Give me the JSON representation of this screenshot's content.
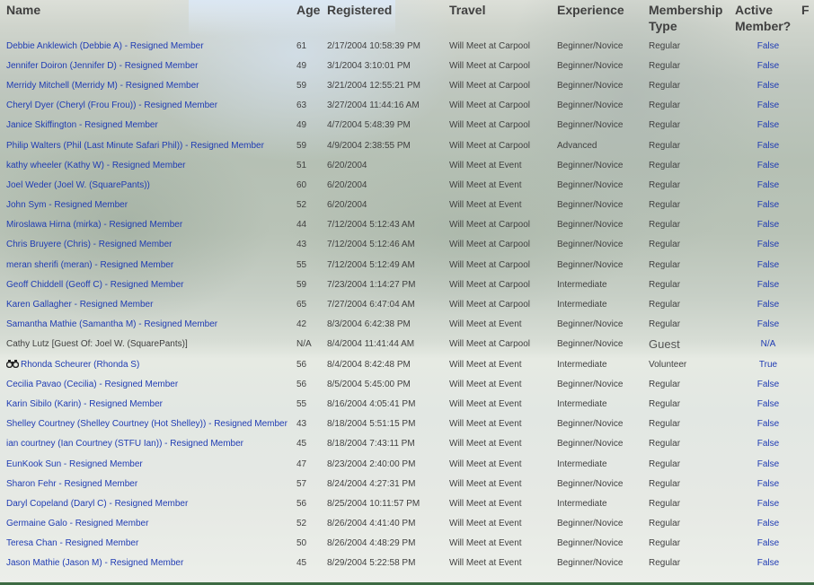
{
  "headers": {
    "name": "Name",
    "age": "Age",
    "registered": "Registered",
    "travel": "Travel",
    "experience": "Experience",
    "membership_type": "Membership Type",
    "active_member": "Active Member?",
    "extra": "F"
  },
  "rows": [
    {
      "name": "Debbie Anklewich (Debbie A) - Resigned Member",
      "age": "61",
      "registered": "2/17/2004 10:58:39 PM",
      "travel": "Will Meet at Carpool",
      "experience": "Beginner/Novice",
      "membership": "Regular",
      "active": "False"
    },
    {
      "name": "Jennifer Doiron (Jennifer D) - Resigned Member",
      "age": "49",
      "registered": "3/1/2004 3:10:01 PM",
      "travel": "Will Meet at Carpool",
      "experience": "Beginner/Novice",
      "membership": "Regular",
      "active": "False"
    },
    {
      "name": "Merridy Mitchell (Merridy M) - Resigned Member",
      "age": "59",
      "registered": "3/21/2004 12:55:21 PM",
      "travel": "Will Meet at Carpool",
      "experience": "Beginner/Novice",
      "membership": "Regular",
      "active": "False"
    },
    {
      "name": "Cheryl Dyer (Cheryl (Frou Frou)) - Resigned Member",
      "age": "63",
      "registered": "3/27/2004 11:44:16 AM",
      "travel": "Will Meet at Carpool",
      "experience": "Beginner/Novice",
      "membership": "Regular",
      "active": "False"
    },
    {
      "name": "Janice Skiffington - Resigned Member",
      "age": "49",
      "registered": "4/7/2004 5:48:39 PM",
      "travel": "Will Meet at Carpool",
      "experience": "Beginner/Novice",
      "membership": "Regular",
      "active": "False"
    },
    {
      "name": "Philip Walters (Phil (Last Minute Safari Phil)) - Resigned Member",
      "age": "59",
      "registered": "4/9/2004 2:38:55 PM",
      "travel": "Will Meet at Carpool",
      "experience": "Advanced",
      "membership": "Regular",
      "active": "False"
    },
    {
      "name": "kathy wheeler (Kathy W) - Resigned Member",
      "age": "51",
      "registered": "6/20/2004",
      "travel": "Will Meet at Event",
      "experience": "Beginner/Novice",
      "membership": "Regular",
      "active": "False"
    },
    {
      "name": "Joel Weder (Joel W. (SquarePants))",
      "age": "60",
      "registered": "6/20/2004",
      "travel": "Will Meet at Event",
      "experience": "Beginner/Novice",
      "membership": "Regular",
      "active": "False"
    },
    {
      "name": "John Sym - Resigned Member",
      "age": "52",
      "registered": "6/20/2004",
      "travel": "Will Meet at Event",
      "experience": "Beginner/Novice",
      "membership": "Regular",
      "active": "False"
    },
    {
      "name": "Miroslawa Hirna (mirka) - Resigned Member",
      "age": "44",
      "registered": "7/12/2004 5:12:43 AM",
      "travel": "Will Meet at Carpool",
      "experience": "Beginner/Novice",
      "membership": "Regular",
      "active": "False"
    },
    {
      "name": "Chris Bruyere (Chris) - Resigned Member",
      "age": "43",
      "registered": "7/12/2004 5:12:46 AM",
      "travel": "Will Meet at Carpool",
      "experience": "Beginner/Novice",
      "membership": "Regular",
      "active": "False"
    },
    {
      "name": "meran sherifi (meran) - Resigned Member",
      "age": "55",
      "registered": "7/12/2004 5:12:49 AM",
      "travel": "Will Meet at Carpool",
      "experience": "Beginner/Novice",
      "membership": "Regular",
      "active": "False"
    },
    {
      "name": "Geoff Chiddell (Geoff C) - Resigned Member",
      "age": "59",
      "registered": "7/23/2004 1:14:27 PM",
      "travel": "Will Meet at Carpool",
      "experience": "Intermediate",
      "membership": "Regular",
      "active": "False"
    },
    {
      "name": "Karen Gallagher - Resigned Member",
      "age": "65",
      "registered": "7/27/2004 6:47:04 AM",
      "travel": "Will Meet at Carpool",
      "experience": "Intermediate",
      "membership": "Regular",
      "active": "False"
    },
    {
      "name": "Samantha Mathie (Samantha M) - Resigned Member",
      "age": "42",
      "registered": "8/3/2004 6:42:38 PM",
      "travel": "Will Meet at Event",
      "experience": "Beginner/Novice",
      "membership": "Regular",
      "active": "False"
    },
    {
      "name": "Cathy Lutz [Guest Of: Joel W. (SquarePants)]",
      "age": "N/A",
      "registered": "8/4/2004 11:41:44 AM",
      "travel": "Will Meet at Carpool",
      "experience": "Beginner/Novice",
      "membership": "Guest",
      "active": "N/A",
      "guest": true
    },
    {
      "name": "Rhonda Scheurer (Rhonda S)",
      "age": "56",
      "registered": "8/4/2004 8:42:48 PM",
      "travel": "Will Meet at Event",
      "experience": "Intermediate",
      "membership": "Volunteer",
      "active": "True",
      "icon": "binoculars-icon"
    },
    {
      "name": "Cecilia Pavao (Cecilia) - Resigned Member",
      "age": "56",
      "registered": "8/5/2004 5:45:00 PM",
      "travel": "Will Meet at Event",
      "experience": "Beginner/Novice",
      "membership": "Regular",
      "active": "False"
    },
    {
      "name": "Karin Sibilo (Karin) - Resigned Member",
      "age": "55",
      "registered": "8/16/2004 4:05:41 PM",
      "travel": "Will Meet at Event",
      "experience": "Intermediate",
      "membership": "Regular",
      "active": "False"
    },
    {
      "name": "Shelley Courtney (Shelley Courtney (Hot Shelley)) - Resigned Member",
      "age": "43",
      "registered": "8/18/2004 5:51:15 PM",
      "travel": "Will Meet at Event",
      "experience": "Beginner/Novice",
      "membership": "Regular",
      "active": "False"
    },
    {
      "name": "ian courtney (Ian Courtney (STFU Ian)) - Resigned Member",
      "age": "45",
      "registered": "8/18/2004 7:43:11 PM",
      "travel": "Will Meet at Event",
      "experience": "Beginner/Novice",
      "membership": "Regular",
      "active": "False"
    },
    {
      "name": "EunKook Sun - Resigned Member",
      "age": "47",
      "registered": "8/23/2004 2:40:00 PM",
      "travel": "Will Meet at Event",
      "experience": "Intermediate",
      "membership": "Regular",
      "active": "False"
    },
    {
      "name": "Sharon Fehr - Resigned Member",
      "age": "57",
      "registered": "8/24/2004 4:27:31 PM",
      "travel": "Will Meet at Event",
      "experience": "Beginner/Novice",
      "membership": "Regular",
      "active": "False"
    },
    {
      "name": "Daryl Copeland (Daryl C) - Resigned Member",
      "age": "56",
      "registered": "8/25/2004 10:11:57 PM",
      "travel": "Will Meet at Event",
      "experience": "Intermediate",
      "membership": "Regular",
      "active": "False"
    },
    {
      "name": "Germaine Galo - Resigned Member",
      "age": "52",
      "registered": "8/26/2004 4:41:40 PM",
      "travel": "Will Meet at Event",
      "experience": "Beginner/Novice",
      "membership": "Regular",
      "active": "False"
    },
    {
      "name": "Teresa Chan - Resigned Member",
      "age": "50",
      "registered": "8/26/2004 4:48:29 PM",
      "travel": "Will Meet at Event",
      "experience": "Beginner/Novice",
      "membership": "Regular",
      "active": "False"
    },
    {
      "name": "Jason Mathie (Jason M) - Resigned Member",
      "age": "45",
      "registered": "8/29/2004 5:22:58 PM",
      "travel": "Will Meet at Event",
      "experience": "Beginner/Novice",
      "membership": "Regular",
      "active": "False"
    }
  ]
}
